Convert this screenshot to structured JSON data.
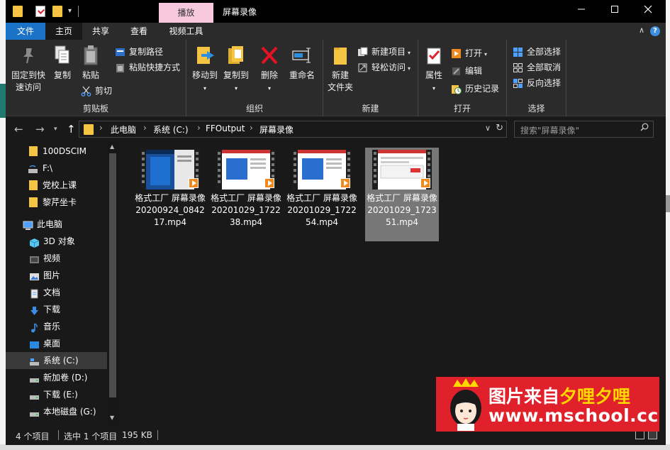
{
  "window": {
    "title": "屏幕录像",
    "contextual_tab": "播放",
    "minimize_icon": "minimize-icon",
    "maximize_icon": "maximize-icon",
    "close_icon": "close-icon"
  },
  "tabs": [
    "文件",
    "主页",
    "共享",
    "查看",
    "视频工具"
  ],
  "ribbon": {
    "clipboard": {
      "label": "剪贴板",
      "pin": "固定到快速访问",
      "pin_line1": "固定到快",
      "pin_line2": "速访问",
      "copy": "复制",
      "paste": "粘贴",
      "copy_path": "复制路径",
      "paste_shortcut": "粘贴快捷方式",
      "cut": "剪切"
    },
    "organize": {
      "label": "组织",
      "move_to": "移动到",
      "copy_to": "复制到",
      "delete": "删除",
      "rename": "重命名"
    },
    "new": {
      "label": "新建",
      "new_folder_line1": "新建",
      "new_folder_line2": "文件夹",
      "new_item": "新建项目",
      "easy_access": "轻松访问"
    },
    "open": {
      "label": "打开",
      "properties": "属性",
      "open": "打开",
      "edit": "编辑",
      "history": "历史记录"
    },
    "select": {
      "label": "选择",
      "select_all": "全部选择",
      "select_none": "全部取消",
      "invert": "反向选择"
    }
  },
  "address": {
    "crumbs": [
      "此电脑",
      "系统 (C:)",
      "FFOutput",
      "屏幕录像"
    ]
  },
  "search": {
    "placeholder": "搜索\"屏幕录像\""
  },
  "nav": {
    "items": [
      {
        "label": "100DSCIM",
        "icon": "folder-icon"
      },
      {
        "label": "F:\\",
        "icon": "drive-icon"
      },
      {
        "label": "党校上课",
        "icon": "folder-icon"
      },
      {
        "label": "黎芹坐卡",
        "icon": "folder-icon"
      },
      {
        "label": "此电脑",
        "icon": "computer-icon"
      },
      {
        "label": "3D 对象",
        "icon": "cube-icon"
      },
      {
        "label": "视频",
        "icon": "video-icon"
      },
      {
        "label": "图片",
        "icon": "picture-icon"
      },
      {
        "label": "文档",
        "icon": "document-icon"
      },
      {
        "label": "下载",
        "icon": "download-icon"
      },
      {
        "label": "音乐",
        "icon": "music-icon"
      },
      {
        "label": "桌面",
        "icon": "desktop-icon"
      },
      {
        "label": "系统 (C:)",
        "icon": "system-drive-icon"
      },
      {
        "label": "新加卷 (D:)",
        "icon": "drive-icon"
      },
      {
        "label": "下载 (E:)",
        "icon": "drive-icon"
      },
      {
        "label": "本地磁盘 (G:)",
        "icon": "drive-icon"
      }
    ]
  },
  "files": [
    {
      "name": "格式工厂 屏幕录像20200924_084217.mp4"
    },
    {
      "name": "格式工厂 屏幕录像20201029_172238.mp4"
    },
    {
      "name": "格式工厂 屏幕录像20201029_172254.mp4"
    },
    {
      "name": "格式工厂 屏幕录像20201029_172351.mp4"
    }
  ],
  "status": {
    "count": "4 个项目",
    "selected": "选中 1 个项目",
    "size": "195 KB"
  },
  "watermark": {
    "line1_a": "图片来自",
    "line1_b": "夕哩夕哩",
    "line2": "www.mschool.cc"
  },
  "colors": {
    "file_tab": "#1a73c7",
    "contextual_tab": "#f8c9dc",
    "folder": "#f5c442",
    "watermark_bg": "#e0202a",
    "watermark_highlight": "#ffd800"
  }
}
